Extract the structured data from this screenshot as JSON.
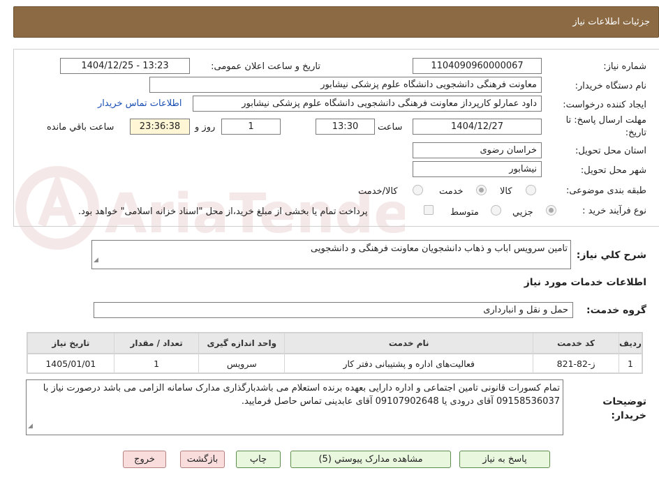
{
  "header": {
    "title": "جزئیات اطلاعات نیاز"
  },
  "form": {
    "need_number_label": "شماره نیاز:",
    "need_number": "1104090960000067",
    "announce_label": "تاریخ و ساعت اعلان عمومی:",
    "announce_value": "1404/12/25 - 13:23",
    "buyer_org_label": "نام دستگاه خریدار:",
    "buyer_org": "معاونت فرهنگی دانشجویی دانشگاه علوم پزشکی نیشابور",
    "requester_label": "ایجاد کننده درخواست:",
    "requester": "داود عمارلو کارپرداز معاونت فرهنگی دانشجویی دانشگاه علوم پزشکی نیشابور",
    "contact_link": "اطلاعات تماس خریدار",
    "deadline_label": "مهلت ارسال پاسخ: تا تاریخ:",
    "deadline_date": "1404/12/27",
    "time_label": "ساعت",
    "deadline_time": "13:30",
    "days_value": "1",
    "days_label": "روز و",
    "remaining_time": "23:36:38",
    "remaining_label": "ساعت باقي مانده",
    "province_label": "استان محل تحویل:",
    "province": "خراسان رضوی",
    "city_label": "شهر محل تحویل:",
    "city": "نیشابور",
    "category_label": "طبقه بندی موضوعی:",
    "category_options": [
      "کالا",
      "خدمت",
      "کالا/خدمت"
    ],
    "category_selected": "خدمت",
    "process_label": "نوع فرآیند خرید :",
    "process_options": [
      "جزيي",
      "متوسط"
    ],
    "payment_note": "پرداخت تمام یا بخشی از مبلغ خرید،از محل \"اسناد خزانه اسلامی\" خواهد بود."
  },
  "description": {
    "label": "شرح کلي نياز:",
    "value": "تامین سرویس اباب و ذهاب دانشجویان معاونت فرهنگی و دانشجویی"
  },
  "services_section": {
    "title": "اطلاعات خدمات مورد نیاز",
    "group_label": "گروه خدمت:",
    "group_value": "حمل و نقل و انبارداری"
  },
  "table": {
    "headers": [
      "ردیف",
      "کد خدمت",
      "نام خدمت",
      "واحد اندازه گیری",
      "تعداد / مقدار",
      "تاریخ نیاز"
    ],
    "rows": [
      [
        "1",
        "ز-82-821",
        "فعالیت‌های اداره و پشتیبانی دفتر کار",
        "سرویس",
        "1",
        "1405/01/01"
      ]
    ]
  },
  "buyer_notes": {
    "label": "توضیحات خریدار:",
    "value": "تمام کسورات قانونی تامین اجتماعی و اداره دارایی بعهده برنده استعلام می باشدبارگذاری مدارک سامانه الزامی می باشد درصورت نیاز با 09158536037 آقای درودی یا 09107902648 آقای عابدینی تماس حاصل فرمایید."
  },
  "buttons": {
    "reply": "پاسخ به نیاز",
    "attachments": "مشاهده مدارک پیوستي (5)",
    "print": "چاپ",
    "back": "بازگشت",
    "exit": "خروج"
  },
  "watermark": {
    "text": "AriaTender.neT"
  },
  "colors": {
    "header": "#8c6a44",
    "link": "#1a4fb3",
    "highlight": "#fff6d6",
    "green_button": "#e9f7df",
    "pink_button": "#f9dcdc"
  }
}
